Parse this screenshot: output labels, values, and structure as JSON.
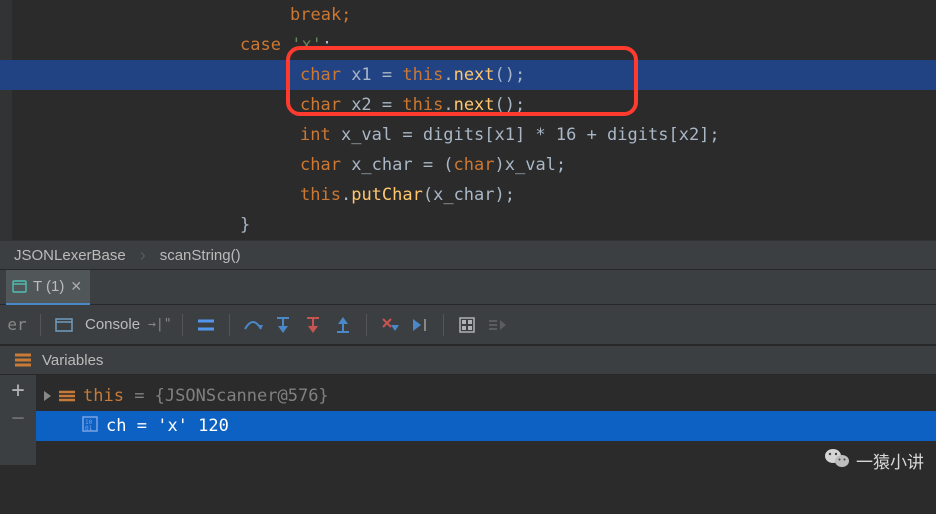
{
  "code": {
    "l0": "break;",
    "l1_case": "case",
    "l1_lit": "'x'",
    "l1_colon": ":",
    "l2_kw": "char",
    "l2_rest": " x1 = ",
    "l2_this": "this",
    "l2_dot": ".",
    "l2_call": "next",
    "l2_tail": "();",
    "l3_kw": "char",
    "l3_rest": " x2 = ",
    "l3_this": "this",
    "l3_call": "next",
    "l3_tail": "();",
    "l4_kw": "int",
    "l4_rest": " x_val = digits[x1] * 16 + digits[x2];",
    "l5_kw": "char",
    "l5_rest": " x_char = (",
    "l5_cast": "char",
    "l5_tail": ")x_val;",
    "l6_this": "this",
    "l6_call": "putChar",
    "l6_tail": "(x_char);",
    "l7_brace": "}"
  },
  "breadcrumb": {
    "class": "JSONLexerBase",
    "method": "scanString()"
  },
  "tab": {
    "label": "T (1)"
  },
  "toolbar": {
    "console": "Console"
  },
  "variables": {
    "title": "Variables",
    "row0_name": "this",
    "row0_eq": " = ",
    "row0_val": "{JSONScanner@576}",
    "row1_name": "ch",
    "row1_eq": " = ",
    "row1_val": "'x' 120"
  },
  "watermark": "一猿小讲"
}
